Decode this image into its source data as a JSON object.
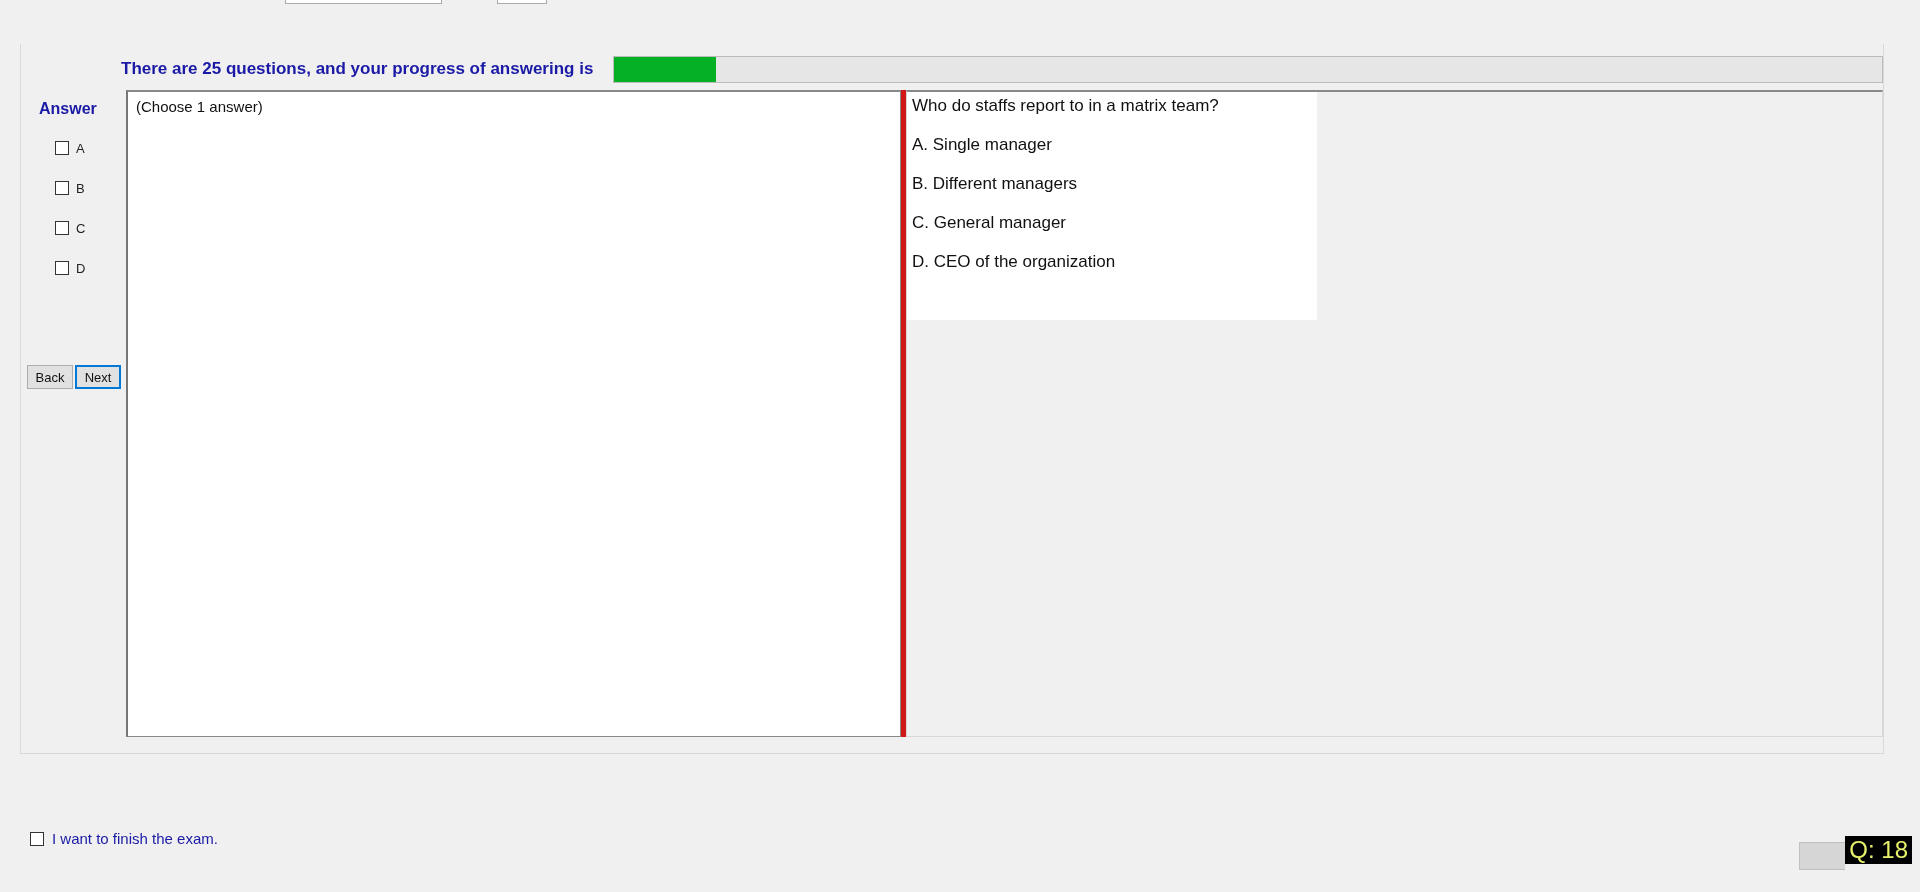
{
  "progress": {
    "label": "There are 25 questions, and your progress of answering is",
    "level": 0.08
  },
  "answer_panel": {
    "title": "Answer",
    "options": [
      {
        "label": "A",
        "checked": false
      },
      {
        "label": "B",
        "checked": false
      },
      {
        "label": "C",
        "checked": false
      },
      {
        "label": "D",
        "checked": false
      }
    ]
  },
  "buttons": [
    {
      "label": "Back",
      "selected": false
    },
    {
      "label": "Next",
      "selected": true
    }
  ],
  "answer_box": {
    "hint": "(Choose 1 answer)"
  },
  "question": {
    "text": "Who do staffs report to in a matrix team?",
    "choices": [
      "A.  Single manager",
      "B.  Different managers",
      "C.  General manager",
      "D.  CEO of the organization"
    ]
  },
  "finish": {
    "label": "I want to finish the exam.",
    "checked": false
  },
  "question_counter": "Q: 18"
}
